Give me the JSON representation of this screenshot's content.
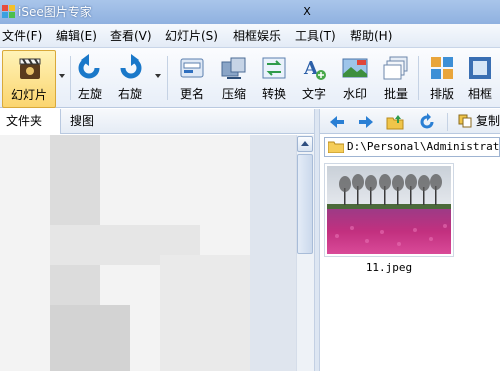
{
  "app": {
    "title": "iSee图片专家"
  },
  "menu": [
    {
      "label": "文件(F)"
    },
    {
      "label": "编辑(E)"
    },
    {
      "label": "查看(V)"
    },
    {
      "label": "幻灯片(S)"
    },
    {
      "label": "相框娱乐"
    },
    {
      "label": "工具(T)"
    },
    {
      "label": "帮助(H)"
    }
  ],
  "toolbar": {
    "slideshow": "幻灯片",
    "rotate_left": "左旋",
    "rotate_right": "右旋",
    "rename": "更名",
    "compress": "压缩",
    "convert": "转换",
    "text": "文字",
    "watermark": "水印",
    "batch": "批量",
    "layout": "排版",
    "frame": "相框"
  },
  "left_panel": {
    "tabs": [
      {
        "label": "文件夹"
      },
      {
        "label": "搜图"
      }
    ],
    "close_label": "X"
  },
  "right_panel": {
    "copy_label": "复制",
    "path": "D:\\Personal\\Administrator\\",
    "files": [
      {
        "name": "11.jpeg"
      }
    ]
  },
  "colors": {
    "accent": "#fbd56f",
    "titlebar": "#9dbce6",
    "thumbnail_flowers": "#c2307f",
    "thumbnail_sky": "#d8dde4"
  }
}
